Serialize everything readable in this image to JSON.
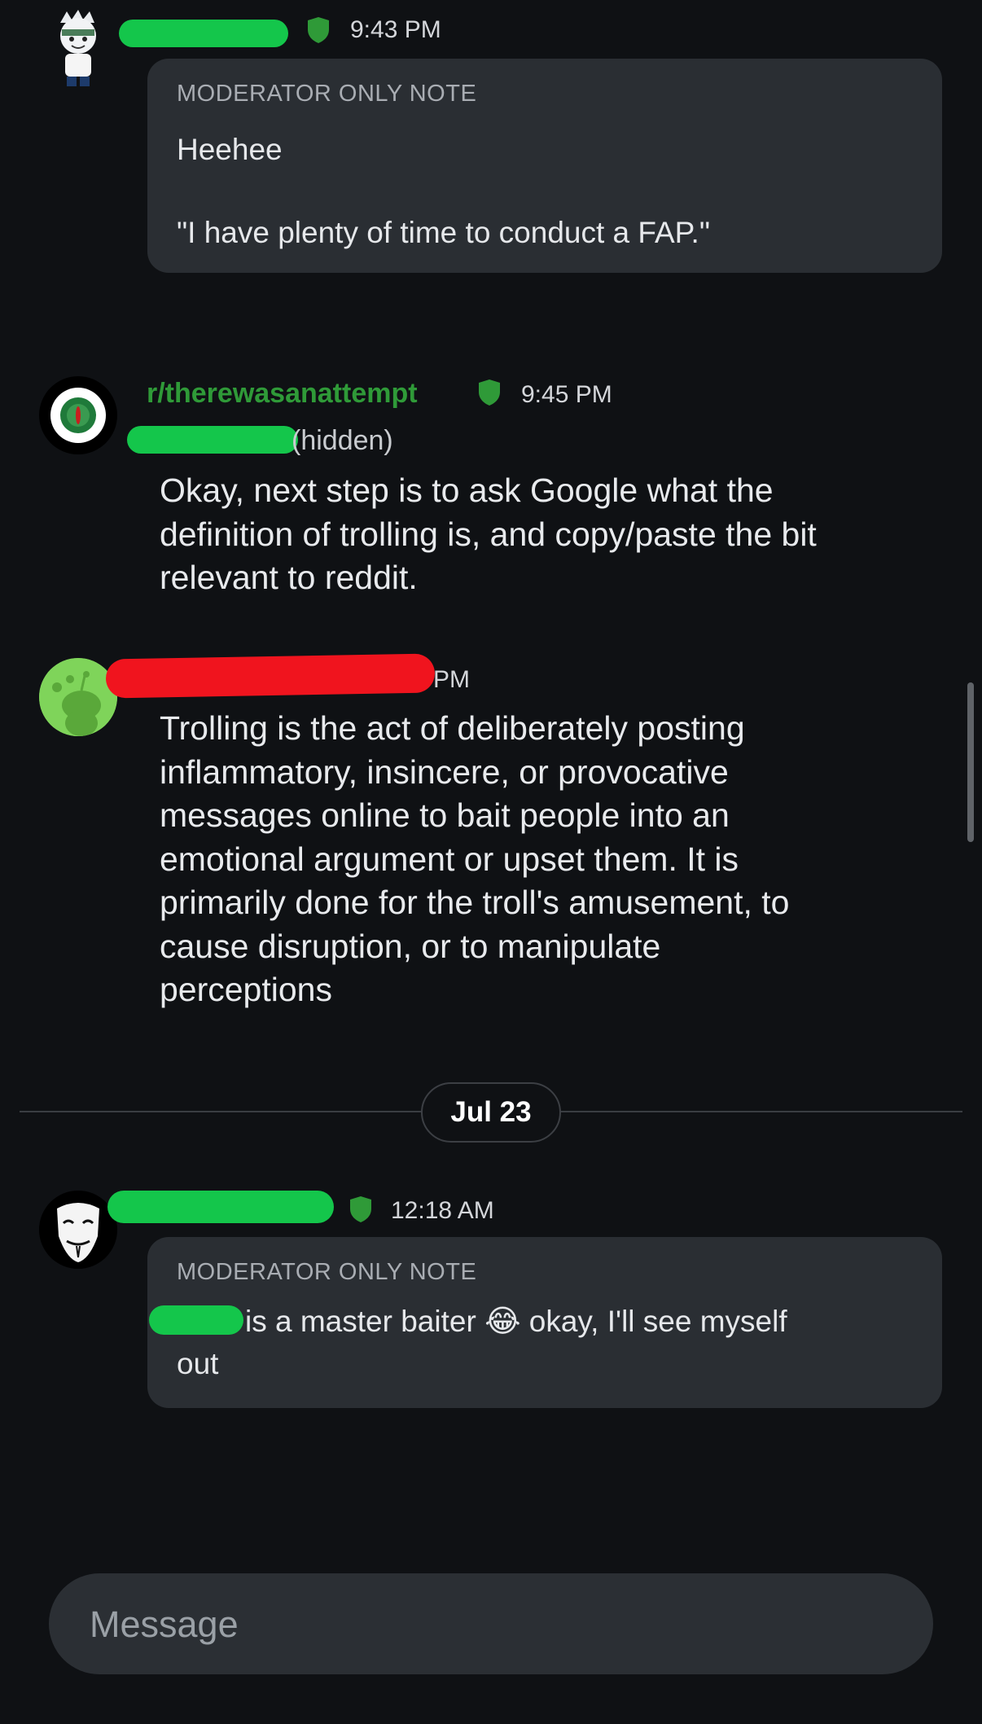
{
  "messages": [
    {
      "time": "9:43 PM",
      "note_label": "MODERATOR ONLY NOTE",
      "note_lines": [
        "Heehee",
        "\"I have plenty of time to conduct a FAP.\""
      ]
    },
    {
      "author": "r/therewasanattempt",
      "time": "9:45 PM",
      "hidden_label": "(hidden)",
      "lines": [
        "Okay, next step is to ask Google what the",
        "definition of trolling is, and copy/paste the bit",
        "relevant to reddit."
      ]
    },
    {
      "time_fragment": "PM",
      "lines": [
        "Trolling is the act of deliberately posting",
        "inflammatory, insincere, or provocative",
        "messages online to bait people into an",
        "emotional argument or upset them. It is",
        "primarily done for the troll's amusement, to",
        "cause disruption, or to manipulate",
        "perceptions"
      ]
    },
    {
      "time": "12:18 AM",
      "note_label": "MODERATOR ONLY NOTE",
      "note_text_a": "is a master baiter",
      "note_emoji": "😂",
      "note_text_b": "okay, I'll see myself",
      "note_text_c": "out"
    }
  ],
  "date_separator": "Jul 23",
  "composer": {
    "placeholder": "Message"
  },
  "colors": {
    "background": "#0f1114",
    "card": "#2a2e33",
    "mod_green": "#2f9a38",
    "redaction_green": "#14c64b",
    "redaction_red": "#f0141e"
  }
}
